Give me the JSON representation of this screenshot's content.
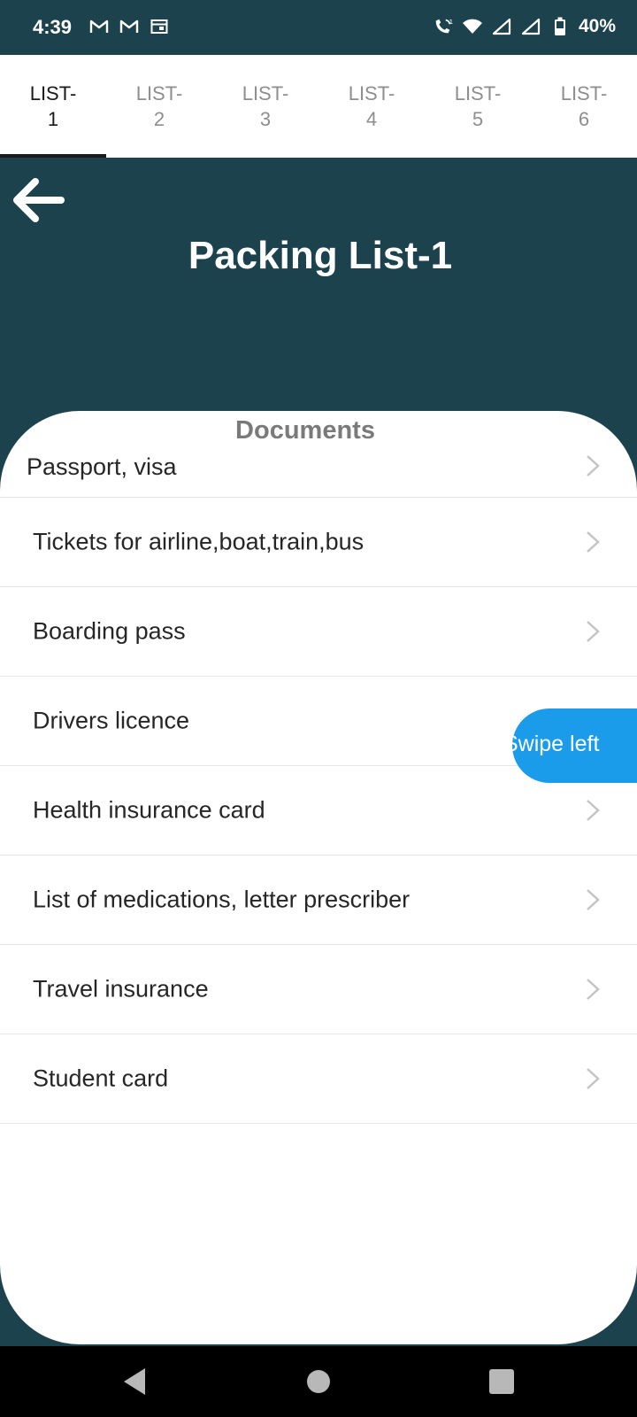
{
  "status_bar": {
    "time": "4:39",
    "battery": "40%",
    "left_icons": [
      "gmail-icon",
      "gmail-icon",
      "calendar-icon"
    ],
    "right_icons": [
      "wifi-calling-icon",
      "wifi-icon",
      "signal-icon",
      "signal-icon",
      "battery-icon"
    ]
  },
  "tabs": [
    {
      "label": "LIST-1",
      "active": true
    },
    {
      "label": "LIST-2",
      "active": false
    },
    {
      "label": "LIST-3",
      "active": false
    },
    {
      "label": "LIST-4",
      "active": false
    },
    {
      "label": "LIST-5",
      "active": false
    },
    {
      "label": "LIST-6",
      "active": false
    }
  ],
  "header": {
    "title": "Packing List-1",
    "back_icon": "arrow-left-icon"
  },
  "section": {
    "title": "Documents",
    "items": [
      {
        "label": "Passport, visa"
      },
      {
        "label": "Tickets for airline,boat,train,bus"
      },
      {
        "label": "Boarding pass"
      },
      {
        "label": "Drivers licence"
      },
      {
        "label": "Health insurance card"
      },
      {
        "label": "List of medications, letter prescriber"
      },
      {
        "label": "Travel insurance"
      },
      {
        "label": "Student card"
      }
    ]
  },
  "swipe_hint": {
    "text": "Swipe left"
  },
  "colors": {
    "header_bg": "#1c424e",
    "swipe_hint_bg": "#1b9ceb",
    "active_tab": "#1a1a1a",
    "inactive_tab": "#8e8e8e"
  },
  "nav": {
    "icons": [
      "back-triangle-icon",
      "home-circle-icon",
      "recents-square-icon"
    ]
  }
}
